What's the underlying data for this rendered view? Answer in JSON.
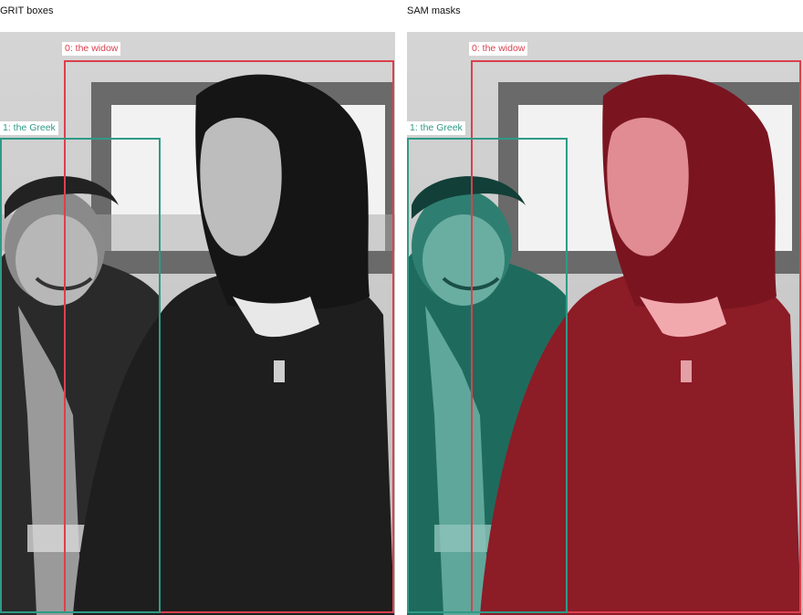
{
  "panels": {
    "left": {
      "title": "GRIT boxes"
    },
    "right": {
      "title": "SAM masks"
    }
  },
  "detections": [
    {
      "label": "0: the widow",
      "color": "#d9414e"
    },
    {
      "label": "1: the Greek",
      "color": "#2f9a88"
    }
  ],
  "colors": {
    "widow_mask": "#8c1c26",
    "greek_mask": "#1e6b5e"
  }
}
